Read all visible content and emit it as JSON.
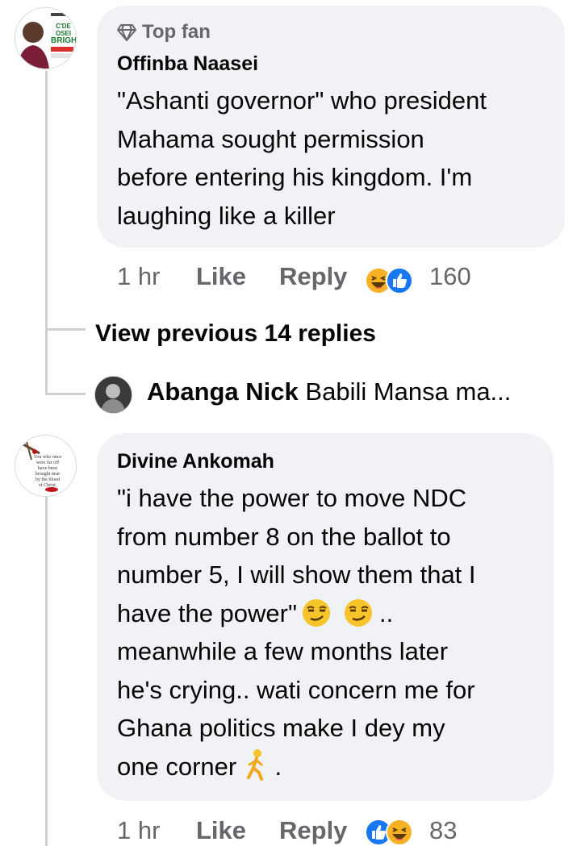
{
  "comments": [
    {
      "badge": "Top fan",
      "author": "Offinba Naasei",
      "lines": [
        "\"Ashanti governor\" who president",
        "Mahama sought permission",
        "before entering his kingdom. I'm",
        "laughing like a killer"
      ],
      "time": "1 hr",
      "like_label": "Like",
      "reply_label": "Reply",
      "reactions": [
        "haha",
        "like"
      ],
      "reaction_count": "160",
      "avatar_text": [
        "C'DE OSEI",
        "BRIGHT"
      ]
    },
    {
      "author": "Divine Ankomah",
      "lines": [
        "\"i have the power to move NDC",
        "from number 8 on the ballot to",
        "number 5, I will show them that I",
        "have the power\"",
        "meanwhile a few months later",
        "he's crying.. wati concern me for",
        "Ghana politics make I dey my",
        "one corner"
      ],
      "line4_suffix": "..",
      "line8_suffix": ".",
      "time": "1 hr",
      "like_label": "Like",
      "reply_label": "Reply",
      "reactions": [
        "like",
        "haha"
      ],
      "reaction_count": "83",
      "avatar_text": [
        "You who once",
        "were far off",
        "have been",
        "brought near",
        "by the blood",
        "of Christ."
      ]
    }
  ],
  "replies": {
    "view_previous": "View previous 14 replies",
    "preview_author": "Abanga Nick",
    "preview_text": "Babili Mansa ma..."
  },
  "colors": {
    "bubble": "#f0f2f5",
    "meta": "#65676b",
    "like_blue": "#1877f2",
    "haha_yellow": "#f7b125"
  }
}
